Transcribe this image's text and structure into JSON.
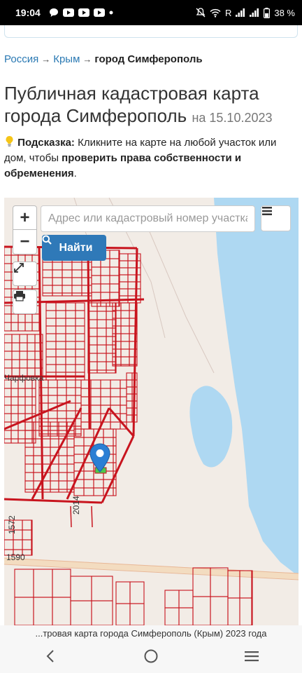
{
  "status_bar": {
    "time": "19:04",
    "roaming": "R",
    "battery": "38 %"
  },
  "breadcrumb": {
    "items": [
      "Россия",
      "Крым"
    ],
    "separator": "→",
    "current": "город Симферополь"
  },
  "title": {
    "main": "Публичная кадастровая карта города Симферополь",
    "date": "на 15.10.2023"
  },
  "hint": {
    "label": "Подсказка:",
    "text_before": "Кликните на карте на любой участок или дом, чтобы",
    "bold": "проверить права собственности и обременения",
    "text_after": "."
  },
  "map": {
    "search_placeholder": "Адрес или кадастровый номер участка",
    "find_label": "Найти",
    "zoom_in": "+",
    "zoom_out": "−",
    "labels": {
      "partial_street": "Чарфовка",
      "plot_2014": "2014",
      "plot_1572": "1572",
      "plot_1590": "1590"
    },
    "colors": {
      "parcel_line": "#c8141e",
      "water": "#aed8f2",
      "land": "#f2ece6",
      "find_button": "#2f79b8",
      "marker": "#2b7fd4"
    }
  },
  "caption": "...тровая карта города Симферополь (Крым) 2023 года",
  "nav": {
    "back": "back-icon",
    "home": "home-icon",
    "recents": "recents-icon"
  }
}
